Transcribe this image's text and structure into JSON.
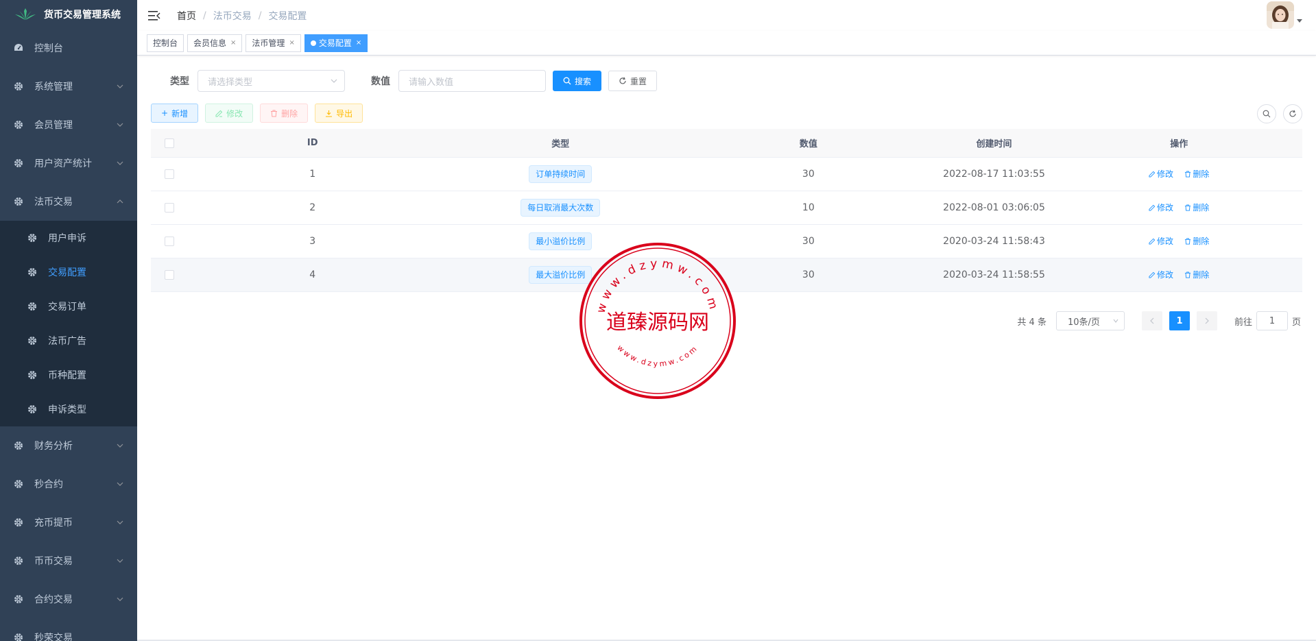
{
  "app": {
    "title": "货币交易管理系统"
  },
  "sidebar": {
    "items": [
      {
        "label": "控制台",
        "has_arrow": false
      },
      {
        "label": "系统管理",
        "has_arrow": true
      },
      {
        "label": "会员管理",
        "has_arrow": true
      },
      {
        "label": "用户资产统计",
        "has_arrow": true
      },
      {
        "label": "法币交易",
        "has_arrow": true,
        "expanded": true
      }
    ],
    "sub_items": [
      {
        "label": "用户申诉"
      },
      {
        "label": "交易配置",
        "active": true
      },
      {
        "label": "交易订单"
      },
      {
        "label": "法币广告"
      },
      {
        "label": "币种配置"
      },
      {
        "label": "申诉类型"
      }
    ],
    "items_after": [
      {
        "label": "财务分析"
      },
      {
        "label": "秒合约"
      },
      {
        "label": "充币提币"
      },
      {
        "label": "币币交易"
      },
      {
        "label": "合约交易"
      },
      {
        "label": "秒荣交易"
      }
    ]
  },
  "breadcrumb": [
    "首页",
    "法币交易",
    "交易配置"
  ],
  "tags": [
    {
      "label": "控制台",
      "closable": false
    },
    {
      "label": "会员信息",
      "closable": true
    },
    {
      "label": "法币管理",
      "closable": true
    },
    {
      "label": "交易配置",
      "closable": true,
      "active": true
    }
  ],
  "search": {
    "type_label": "类型",
    "type_placeholder": "请选择类型",
    "value_label": "数值",
    "value_placeholder": "请输入数值",
    "search_button": "搜索",
    "reset_button": "重置"
  },
  "toolbar": {
    "add": "新增",
    "edit": "修改",
    "delete": "删除",
    "export": "导出"
  },
  "table": {
    "columns": [
      "ID",
      "类型",
      "数值",
      "创建时间",
      "操作"
    ],
    "rows": [
      {
        "id": "1",
        "type": "订单持续时间",
        "value": "30",
        "created": "2022-08-17 11:03:55"
      },
      {
        "id": "2",
        "type": "每日取消最大次数",
        "value": "10",
        "created": "2022-08-01 03:06:05"
      },
      {
        "id": "3",
        "type": "最小溢价比例",
        "value": "30",
        "created": "2020-03-24 11:58:43"
      },
      {
        "id": "4",
        "type": "最大溢价比例",
        "value": "30",
        "created": "2020-03-24 11:58:55"
      }
    ],
    "edit_label": "修改",
    "delete_label": "删除"
  },
  "pagination": {
    "total_text": "共 4 条",
    "page_size": "10条/页",
    "current_page": "1",
    "goto_prefix": "前往",
    "goto_value": "1",
    "goto_suffix": "页"
  },
  "stamp": {
    "center_text": "道臻源码网",
    "top_arc": "www.dzymw.com",
    "bottom_arc": "www.dzymw.com"
  },
  "colors": {
    "sidebar_bg": "#304156",
    "submenu_bg": "#1f2d3d",
    "primary": "#1890ff",
    "stamp_red": "#d9001b"
  }
}
